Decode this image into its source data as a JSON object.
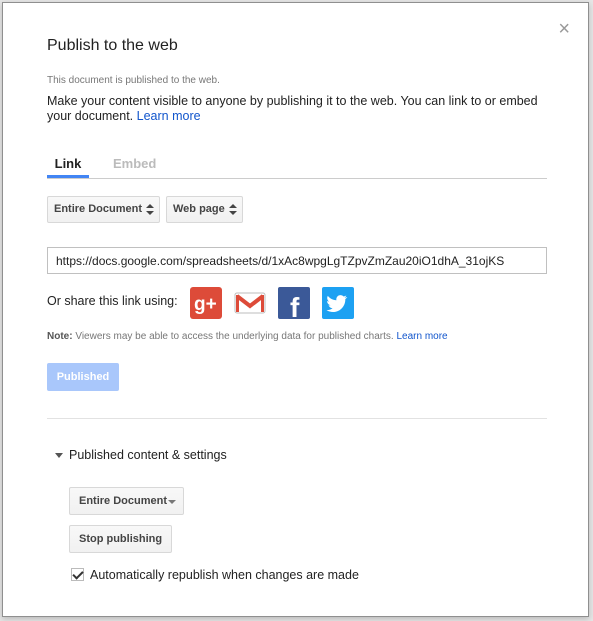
{
  "dialog": {
    "title": "Publish to the web",
    "close_glyph": "×",
    "status": "This document is published to the web.",
    "description": "Make your content visible to anyone by publishing it to the web. You can link to or embed your document.",
    "learn_more": "Learn more",
    "tabs": [
      {
        "label": "Link"
      },
      {
        "label": "Embed"
      }
    ],
    "selects": {
      "document": "Entire Document",
      "format": "Web page"
    },
    "url": "https://docs.google.com/spreadsheets/d/1xAc8wpgLgTZpvZmZau20iO1dhA_31ojKS",
    "share_text": "Or share this link using:",
    "share_icons": [
      "google-plus-icon",
      "gmail-icon",
      "facebook-icon",
      "twitter-icon"
    ],
    "note_label": "Note:",
    "note_text": "Viewers may be able to access the underlying data for published charts.",
    "note_learn_more": "Learn more",
    "published_button": "Published",
    "section_title": "Published content & settings",
    "section_select": "Entire Document",
    "stop_button": "Stop publishing",
    "checkbox_label": "Automatically republish when changes are made",
    "colors": {
      "accent": "#4285f4",
      "link": "#1155cc",
      "published_bg": "#a9c7fb",
      "google_plus": "#dd4b39",
      "facebook": "#3b5998",
      "twitter": "#1da1f2"
    }
  }
}
